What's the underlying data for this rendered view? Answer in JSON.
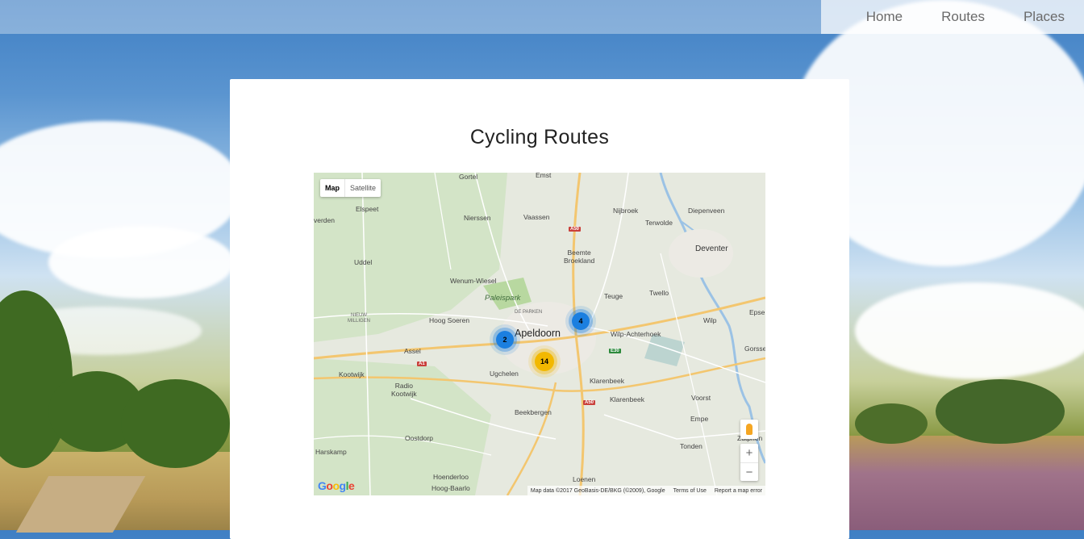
{
  "nav": {
    "items": [
      {
        "label": "Home"
      },
      {
        "label": "Routes"
      },
      {
        "label": "Places"
      }
    ]
  },
  "page": {
    "title": "Cycling Routes"
  },
  "map": {
    "type_control": {
      "map_label": "Map",
      "satellite_label": "Satellite",
      "selected": "Map"
    },
    "places": [
      {
        "name": "Gortel"
      },
      {
        "name": "Emst"
      },
      {
        "name": "Elspeet"
      },
      {
        "name": "Nijbroek"
      },
      {
        "name": "Diepenveen"
      },
      {
        "name": "Terwolde"
      },
      {
        "name": "Nierssen"
      },
      {
        "name": "Vaassen"
      },
      {
        "name": "Uddel"
      },
      {
        "name": "Beemte\nBroekland"
      },
      {
        "name": "Deventer"
      },
      {
        "name": "Wenum-Wiesel"
      },
      {
        "name": "Paleispark"
      },
      {
        "name": "Teuge"
      },
      {
        "name": "Twello"
      },
      {
        "name": "DE PARKEN"
      },
      {
        "name": "Epse"
      },
      {
        "name": "NIEUW\nMILLIGEN"
      },
      {
        "name": "Hoog Soeren"
      },
      {
        "name": "Apeldoorn"
      },
      {
        "name": "Wilp"
      },
      {
        "name": "Wilp-Achterhoek"
      },
      {
        "name": "Assel"
      },
      {
        "name": "Gorssel"
      },
      {
        "name": "Kootwijk"
      },
      {
        "name": "Ugchelen"
      },
      {
        "name": "Klarenbeek"
      },
      {
        "name": "Radio\nKootwijk"
      },
      {
        "name": "Klarenbeek"
      },
      {
        "name": "Voorst"
      },
      {
        "name": "Beekbergen"
      },
      {
        "name": "Empe"
      },
      {
        "name": "Oostdorp"
      },
      {
        "name": "Zutphen"
      },
      {
        "name": "Harskamp"
      },
      {
        "name": "Tonden"
      },
      {
        "name": "Hoenderloo"
      },
      {
        "name": "Loenen"
      },
      {
        "name": "Hoog-Baarlo"
      },
      {
        "name": "verden"
      }
    ],
    "road_shields": [
      {
        "label": "A50"
      },
      {
        "label": "A1"
      },
      {
        "label": "E30"
      },
      {
        "label": "A50"
      }
    ],
    "clusters": [
      {
        "count": "2",
        "color": "#1b7fe0"
      },
      {
        "count": "4",
        "color": "#1b7fe0"
      },
      {
        "count": "14",
        "color": "#f2b800"
      }
    ],
    "zoom_in": "+",
    "zoom_out": "−",
    "google_logo": "Google",
    "attribution": {
      "data": "Map data ©2017 GeoBasis-DE/BKG (©2009), Google",
      "terms": "Terms of Use",
      "report": "Report a map error"
    }
  }
}
